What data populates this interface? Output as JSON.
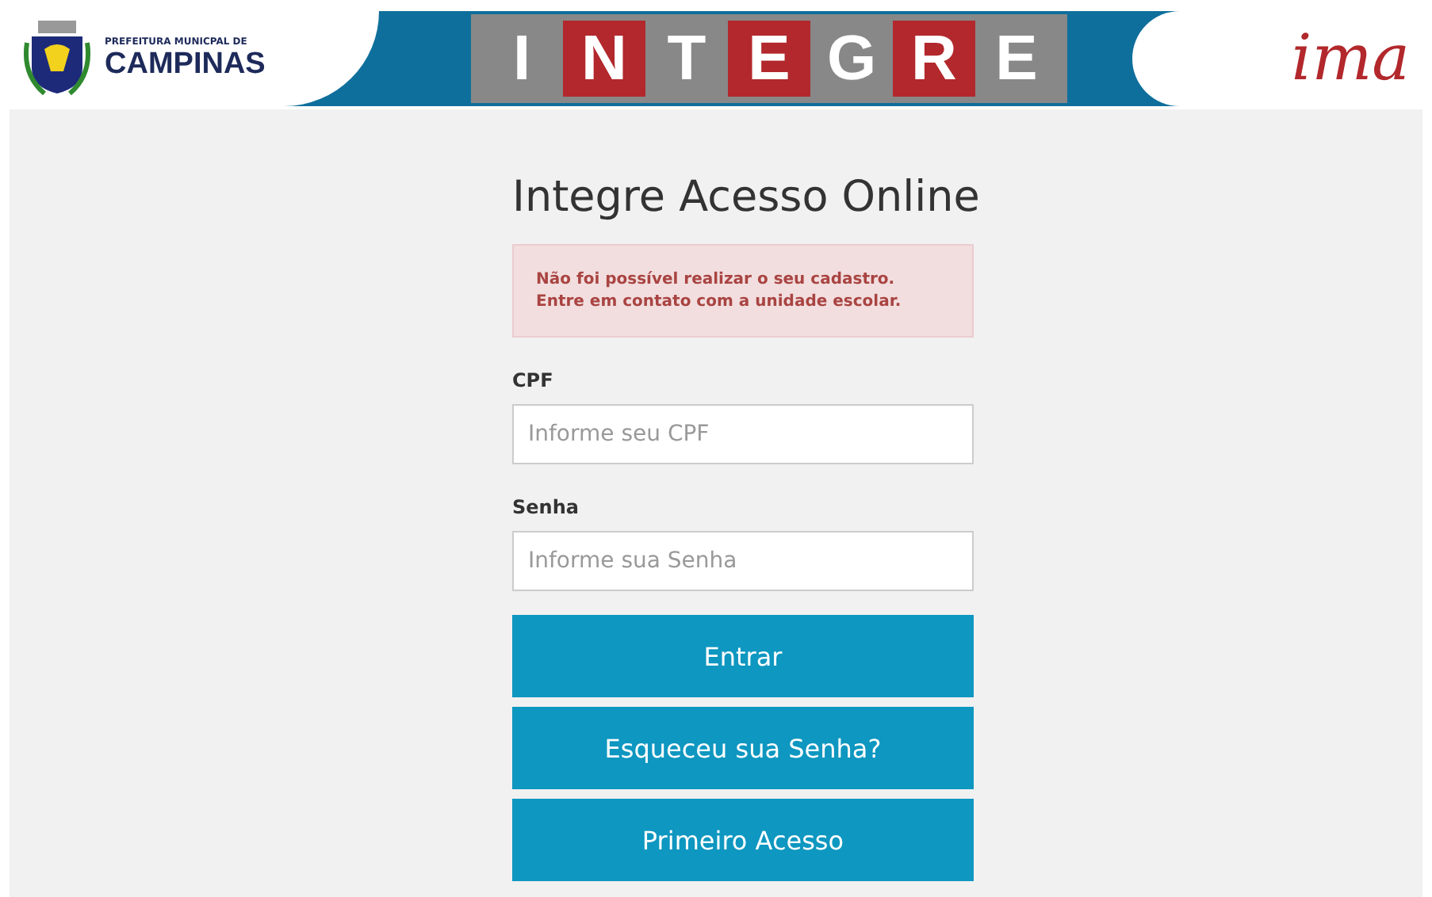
{
  "header": {
    "city_logo": {
      "line1": "PREFEITURA MUNICPAL DE",
      "line2": "CAMPINAS"
    },
    "product_logo": {
      "letters": [
        "I",
        "N",
        "T",
        "E",
        "G",
        "R",
        "E"
      ]
    },
    "partner_logo": {
      "text": "ima"
    }
  },
  "form": {
    "title": "Integre Acesso Online",
    "alert": {
      "kind": "error",
      "lines": [
        "Não foi possível realizar o seu cadastro.",
        "Entre em contato com a unidade escolar."
      ]
    },
    "fields": [
      {
        "label": "CPF",
        "placeholder": "Informe seu CPF"
      },
      {
        "label": "Senha",
        "placeholder": "Informe sua Senha"
      }
    ],
    "buttons": [
      "Entrar",
      "Esqueceu sua Senha?",
      "Primeiro Acesso"
    ]
  }
}
